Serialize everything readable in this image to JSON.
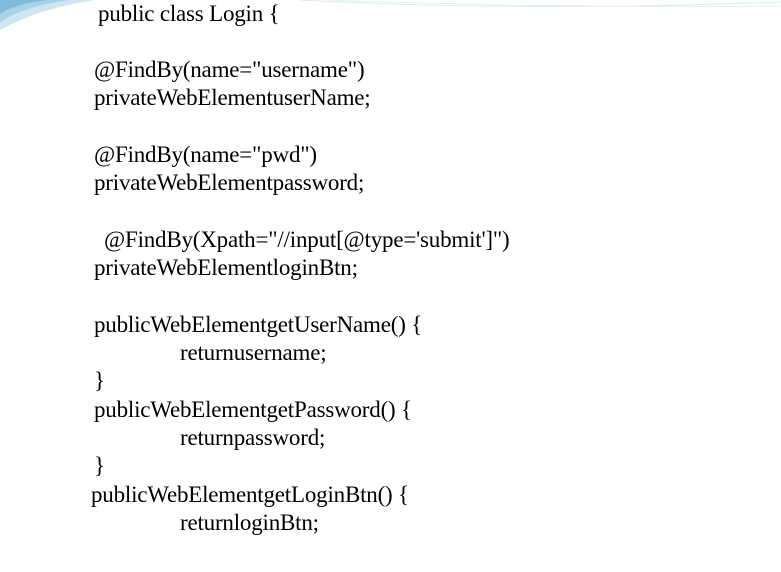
{
  "lines": [
    "public class Login {",
    "@FindBy(name=\"username\")",
    "privateWebElementuserName;",
    "@FindBy(name=\"pwd\")",
    "privateWebElementpassword;",
    "@FindBy(Xpath=\"//input[@type='submit']\")",
    "privateWebElementloginBtn;",
    "publicWebElementgetUserName() {",
    "returnusername;",
    "}",
    "publicWebElementgetPassword() {",
    "returnpassword;",
    "}",
    "publicWebElementgetLoginBtn() {",
    "returnloginBtn;"
  ]
}
